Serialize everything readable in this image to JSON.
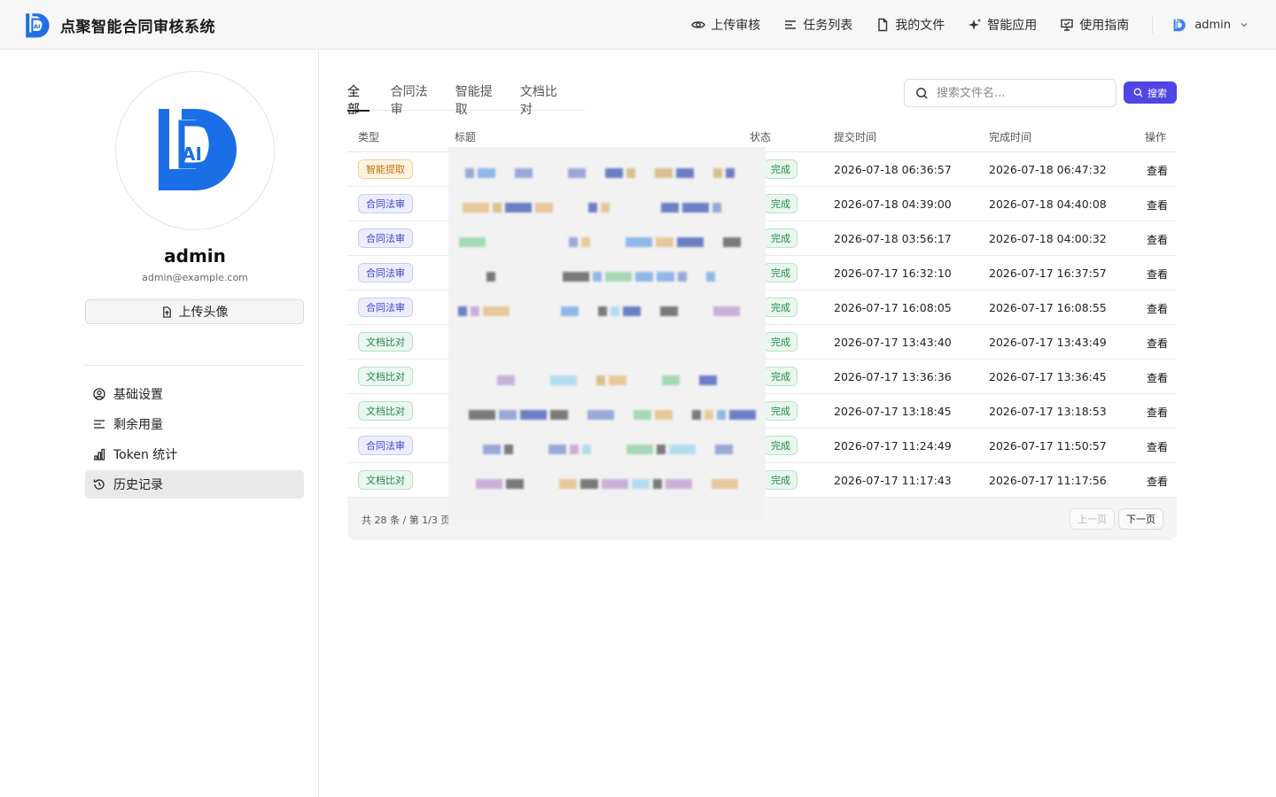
{
  "app": {
    "title": "点聚智能合同审核系统"
  },
  "nav": {
    "items": [
      {
        "label": "上传审核",
        "icon": "eye-icon"
      },
      {
        "label": "任务列表",
        "icon": "list-icon"
      },
      {
        "label": "我的文件",
        "icon": "file-icon"
      },
      {
        "label": "智能应用",
        "icon": "sparkle-icon"
      },
      {
        "label": "使用指南",
        "icon": "guide-icon"
      }
    ],
    "user": "admin"
  },
  "profile": {
    "name": "admin",
    "email": "admin@example.com",
    "upload_avatar_label": "上传头像"
  },
  "sidebar": {
    "items": [
      {
        "label": "基础设置",
        "icon": "user-circle-icon"
      },
      {
        "label": "剩余用量",
        "icon": "lines-icon"
      },
      {
        "label": "Token 统计",
        "icon": "bar-chart-icon"
      },
      {
        "label": "历史记录",
        "icon": "history-icon",
        "active": true
      }
    ]
  },
  "tabs": [
    "全部",
    "合同法审",
    "智能提取",
    "文档比对"
  ],
  "search": {
    "placeholder": "搜索文件名...",
    "button_label": "搜索"
  },
  "table": {
    "columns": [
      "类型",
      "标题",
      "状态",
      "提交时间",
      "完成时间",
      "操作"
    ],
    "rows": [
      {
        "type": "智能提取",
        "status": "完成",
        "submitted": "2026-07-18 06:36:57",
        "completed": "2026-07-18 06:47:32",
        "action": "查看"
      },
      {
        "type": "合同法审",
        "status": "完成",
        "submitted": "2026-07-18 04:39:00",
        "completed": "2026-07-18 04:40:08",
        "action": "查看"
      },
      {
        "type": "合同法审",
        "status": "完成",
        "submitted": "2026-07-18 03:56:17",
        "completed": "2026-07-18 04:00:32",
        "action": "查看"
      },
      {
        "type": "合同法审",
        "status": "完成",
        "submitted": "2026-07-17 16:32:10",
        "completed": "2026-07-17 16:37:57",
        "action": "查看"
      },
      {
        "type": "合同法审",
        "status": "完成",
        "submitted": "2026-07-17 16:08:05",
        "completed": "2026-07-17 16:08:55",
        "action": "查看"
      },
      {
        "type": "文档比对",
        "status": "完成",
        "submitted": "2026-07-17 13:43:40",
        "completed": "2026-07-17 13:43:49",
        "action": "查看"
      },
      {
        "type": "文档比对",
        "status": "完成",
        "submitted": "2026-07-17 13:36:36",
        "completed": "2026-07-17 13:36:45",
        "action": "查看"
      },
      {
        "type": "文档比对",
        "status": "完成",
        "submitted": "2026-07-17 13:18:45",
        "completed": "2026-07-17 13:18:53",
        "action": "查看"
      },
      {
        "type": "合同法审",
        "status": "完成",
        "submitted": "2026-07-17 11:24:49",
        "completed": "2026-07-17 11:50:57",
        "action": "查看"
      },
      {
        "type": "文档比对",
        "status": "完成",
        "submitted": "2026-07-17 11:17:43",
        "completed": "2026-07-17 11:17:56",
        "action": "查看"
      }
    ]
  },
  "pagination": {
    "summary": "共 28 条 / 第 1/3 页",
    "prev_label": "上一页",
    "next_label": "下一页"
  },
  "colors": {
    "accent": "#4f46e5",
    "brand_blue": "#1e6fe8",
    "status_green": "#1f8a49"
  }
}
